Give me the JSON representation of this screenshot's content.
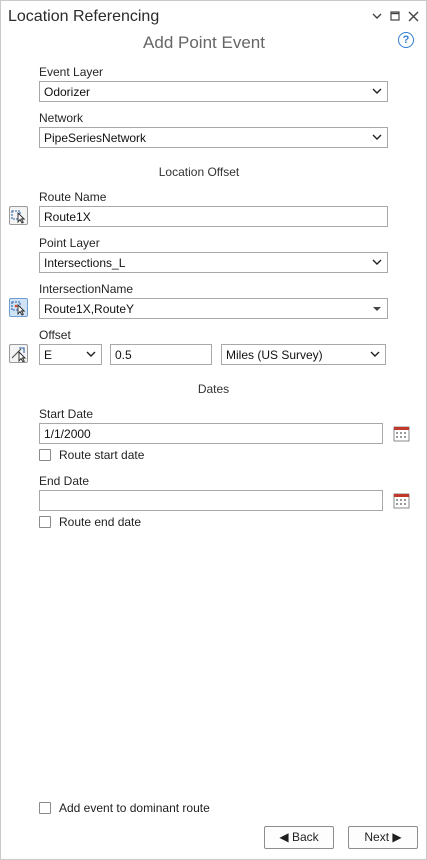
{
  "pane": {
    "title": "Location Referencing",
    "subtitle": "Add Point Event",
    "help": "?"
  },
  "event_layer": {
    "label": "Event Layer",
    "value": "Odorizer"
  },
  "network": {
    "label": "Network",
    "value": "PipeSeriesNetwork"
  },
  "location_offset": {
    "heading": "Location Offset",
    "route_name": {
      "label": "Route Name",
      "value": "Route1X"
    },
    "point_layer": {
      "label": "Point Layer",
      "value": "Intersections_L"
    },
    "intersection_name": {
      "label": "IntersectionName",
      "value": "Route1X,RouteY"
    },
    "offset": {
      "label": "Offset",
      "direction": "E",
      "value": "0.5",
      "units": "Miles (US Survey)"
    }
  },
  "dates": {
    "heading": "Dates",
    "start_date": {
      "label": "Start Date",
      "value": "1/1/2000",
      "checkbox": "Route start date",
      "checked": false
    },
    "end_date": {
      "label": "End Date",
      "value": "",
      "checkbox": "Route end date",
      "checked": false
    }
  },
  "dominant_route": {
    "label": "Add event to dominant route",
    "checked": false
  },
  "buttons": {
    "back": "◀ Back",
    "next": "Next ▶"
  },
  "colors": {
    "accent": "#2f7dd2",
    "calendar": "#c0392b",
    "subtitle": "#666666"
  }
}
